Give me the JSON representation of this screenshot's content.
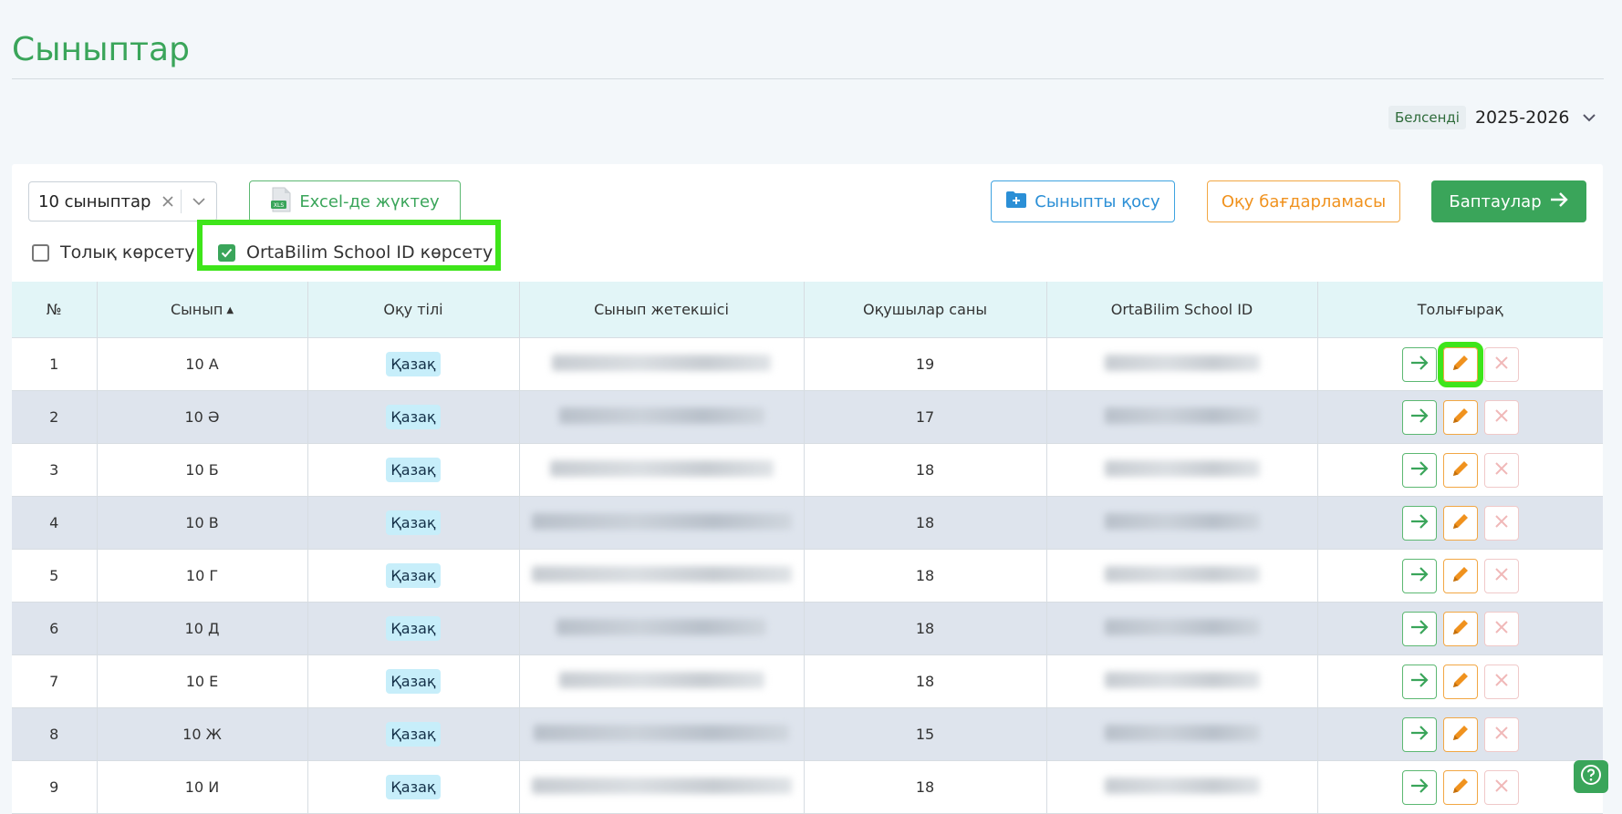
{
  "page": {
    "title": "Сыныптар"
  },
  "year_selector": {
    "status_badge": "Белсенді",
    "value": "2025-2026"
  },
  "toolbar": {
    "class_filter_value": "10 сыныптар",
    "excel_button": "Excel-де жүктеу",
    "add_class_button": "Сыныпты қосу",
    "program_button": "Оқу бағдарламасы",
    "settings_button": "Баптаулар"
  },
  "options": {
    "show_full_label": "Толық көрсету",
    "show_full_checked": false,
    "show_ortabilim_label": "OrtaBilim School ID көрсету",
    "show_ortabilim_checked": true
  },
  "table": {
    "columns": [
      "№",
      "Сынып",
      "Оқу тілі",
      "Сынып жетекшісі",
      "Оқушылар саны",
      "OrtaBilim School ID",
      "Толығырақ"
    ],
    "rows": [
      {
        "num": "1",
        "class": "10 А",
        "language": "Қазақ",
        "students": "19"
      },
      {
        "num": "2",
        "class": "10 Ә",
        "language": "Қазақ",
        "students": "17"
      },
      {
        "num": "3",
        "class": "10 Б",
        "language": "Қазақ",
        "students": "18"
      },
      {
        "num": "4",
        "class": "10 В",
        "language": "Қазақ",
        "students": "18"
      },
      {
        "num": "5",
        "class": "10 Г",
        "language": "Қазақ",
        "students": "18"
      },
      {
        "num": "6",
        "class": "10 Д",
        "language": "Қазақ",
        "students": "18"
      },
      {
        "num": "7",
        "class": "10 Е",
        "language": "Қазақ",
        "students": "18"
      },
      {
        "num": "8",
        "class": "10 Ж",
        "language": "Қазақ",
        "students": "15"
      },
      {
        "num": "9",
        "class": "10 И",
        "language": "Қазақ",
        "students": "18"
      }
    ]
  },
  "colors": {
    "brand_green": "#3aa55a",
    "blue": "#2b8fd6",
    "orange": "#f0921e",
    "highlight": "#3ee51a"
  },
  "icons": [
    "chevron-down-icon",
    "clear-icon",
    "excel-file-icon",
    "folder-plus-icon",
    "arrow-right-icon",
    "pencil-icon",
    "close-icon",
    "help-icon",
    "check-icon"
  ]
}
